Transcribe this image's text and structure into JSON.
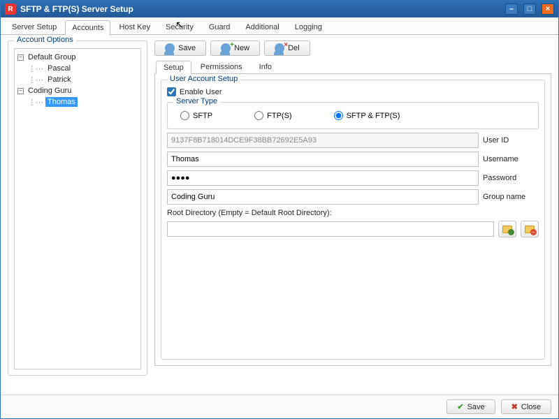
{
  "window": {
    "title": "SFTP & FTP(S) Server Setup"
  },
  "mainTabs": {
    "t0": "Server Setup",
    "t1": "Accounts",
    "t2": "Host Key",
    "t3": "Security",
    "t4": "Guard",
    "t5": "Additional",
    "t6": "Logging",
    "active": 1
  },
  "treeTitle": "Account Options",
  "tree": {
    "g0": "Default Group",
    "g0a": "Pascal",
    "g0b": "Patrick",
    "g1": "Coding Guru",
    "g1a": "Thomas"
  },
  "toolbar": {
    "save": "Save",
    "new": "New",
    "del": "Del"
  },
  "subTabs": {
    "t0": "Setup",
    "t1": "Permissions",
    "t2": "Info",
    "active": 0
  },
  "account": {
    "legend": "User Account Setup",
    "enableLabel": "Enable User",
    "serverTypeLegend": "Server Type",
    "st0": "SFTP",
    "st1": "FTP(S)",
    "st2": "SFTP & FTP(S)",
    "serverTypeSelected": 2,
    "userId": "9137F8B718014DCE9F38BB72692E5A93",
    "userIdLabel": "User ID",
    "username": "Thomas",
    "usernameLabel": "Username",
    "password": "●●●●",
    "passwordLabel": "Password",
    "group": "Coding Guru",
    "groupLabel": "Group name",
    "rootLabel": "Root Directory (Empty = Default Root Directory):",
    "rootValue": ""
  },
  "footer": {
    "save": "Save",
    "close": "Close"
  }
}
